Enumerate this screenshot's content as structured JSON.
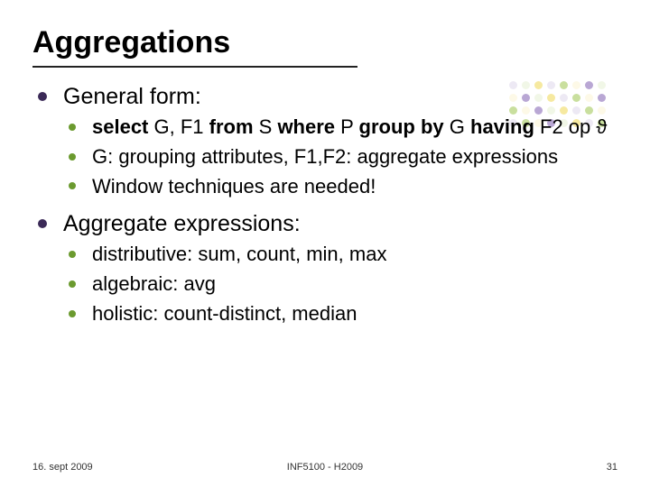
{
  "title": "Aggregations",
  "sections": [
    {
      "heading": "General form:",
      "items": [
        {
          "segments": [
            {
              "t": "select",
              "b": true
            },
            {
              "t": " G, F1 ",
              "b": false
            },
            {
              "t": "from",
              "b": true
            },
            {
              "t": " S ",
              "b": false
            },
            {
              "t": "where",
              "b": true
            },
            {
              "t": " P ",
              "b": false
            },
            {
              "t": "group by",
              "b": true
            },
            {
              "t": " G ",
              "b": false
            },
            {
              "t": "having",
              "b": true
            },
            {
              "t": " F2 op ϑ",
              "b": false
            }
          ]
        },
        {
          "text": "G: grouping attributes, F1,F2: aggregate expressions"
        },
        {
          "text": "Window techniques are needed!"
        }
      ]
    },
    {
      "heading": "Aggregate expressions:",
      "items": [
        {
          "text": "distributive: sum, count, min, max"
        },
        {
          "text": "algebraic: avg"
        },
        {
          "text": "holistic: count-distinct, median"
        }
      ]
    }
  ],
  "footer": {
    "left": "16. sept 2009",
    "center": "INF5100 - H2009",
    "right": "31"
  }
}
